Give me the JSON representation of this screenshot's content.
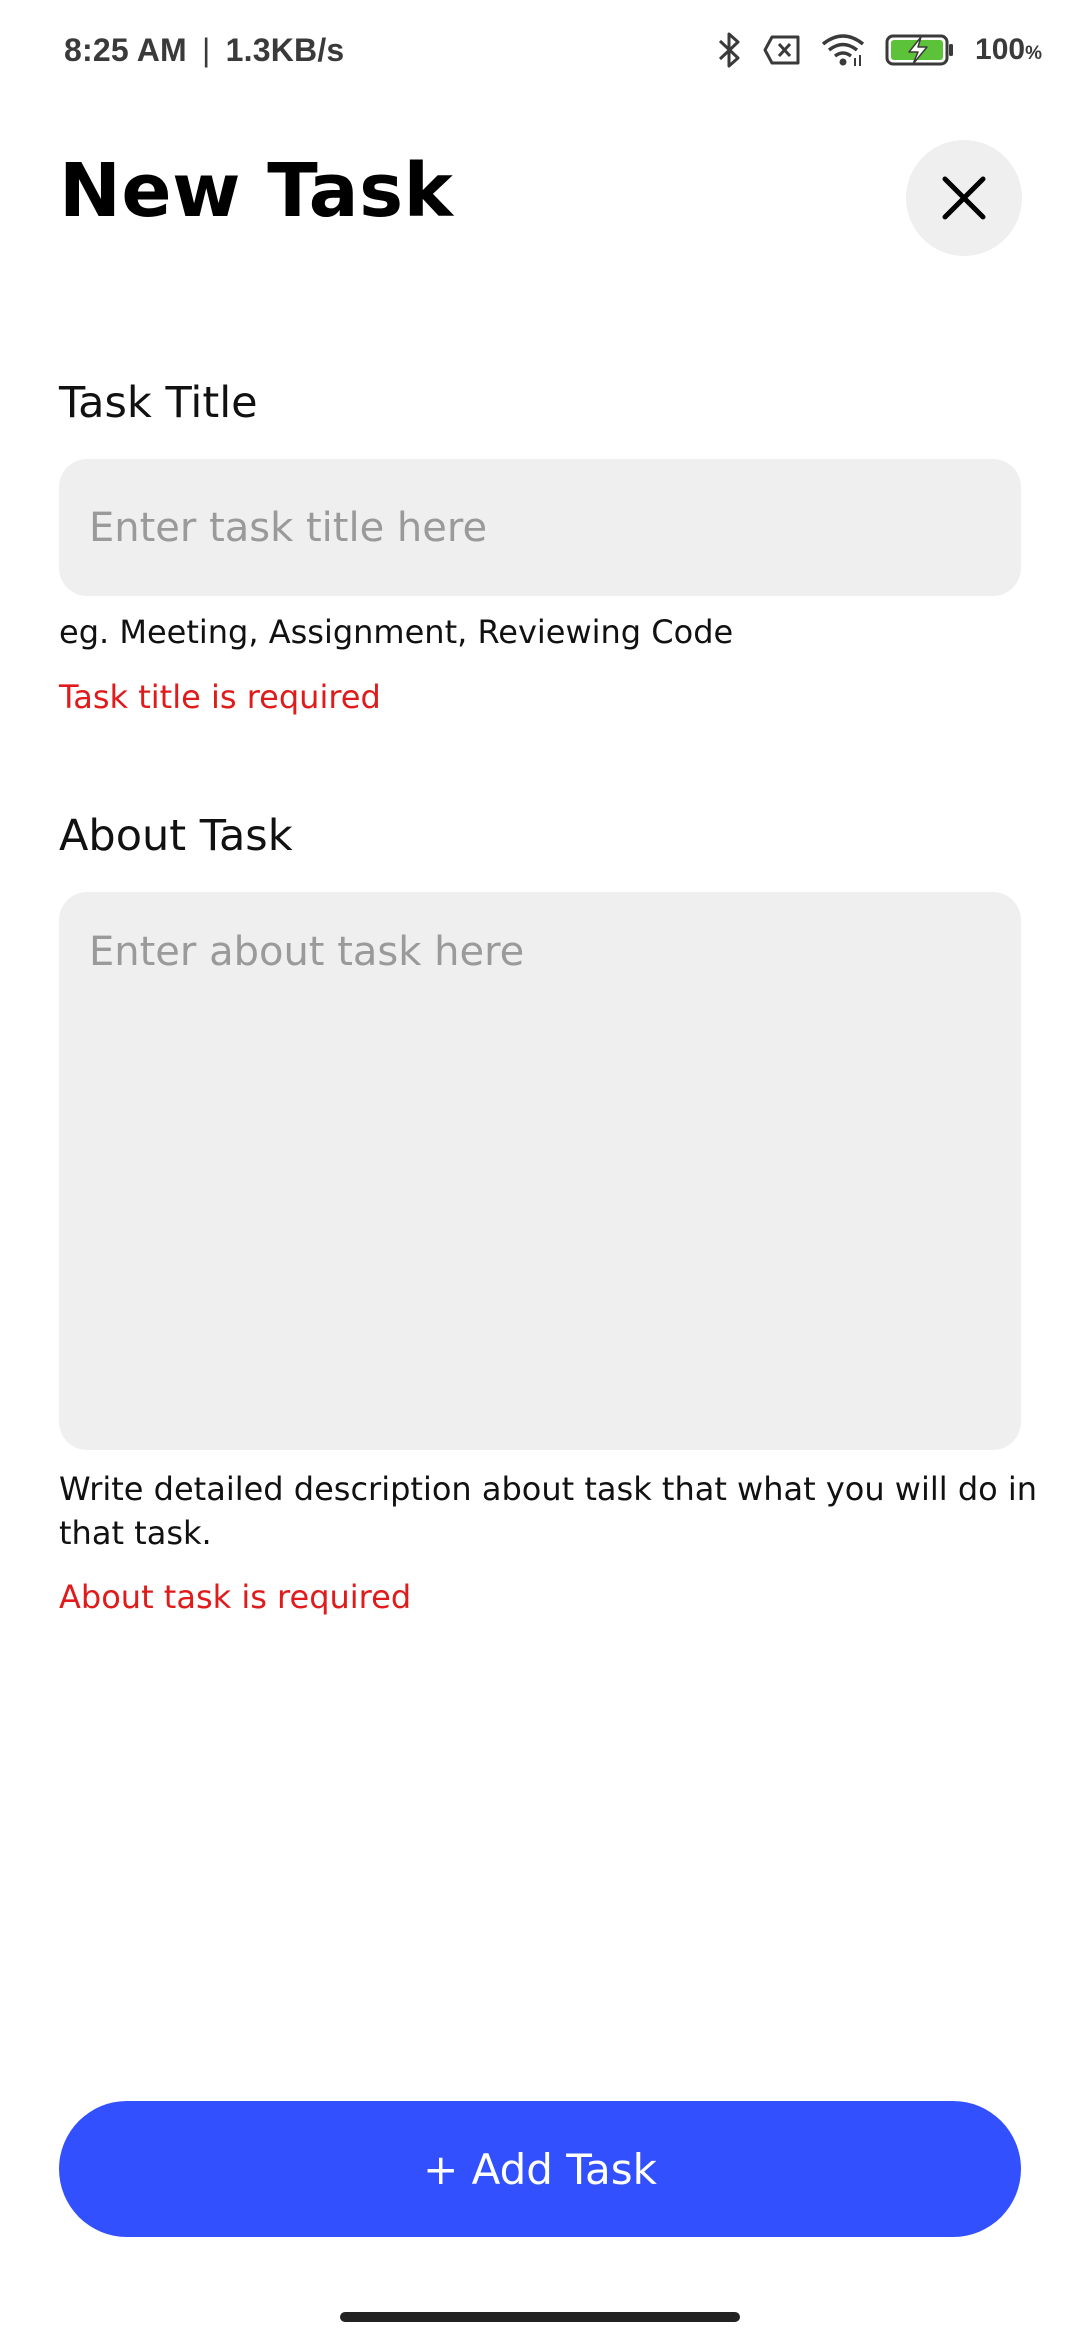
{
  "status_bar": {
    "time": "8:25 AM",
    "separator": "|",
    "network_speed": "1.3KB/s",
    "battery_level": "100",
    "battery_unit": "%",
    "icons": [
      "bluetooth-icon",
      "sim-off-icon",
      "wifi-icon",
      "battery-charging-icon"
    ]
  },
  "header": {
    "title": "New Task",
    "close_icon": "close-icon"
  },
  "task_title": {
    "label": "Task Title",
    "value": "",
    "placeholder": "Enter task title here",
    "helper": "eg. Meeting, Assignment, Reviewing Code",
    "error": "Task title is required"
  },
  "about_task": {
    "label": "About Task",
    "value": "",
    "placeholder": "Enter about task here",
    "helper": "Write detailed description about task that what you will do in that task.",
    "error": "About task is required"
  },
  "actions": {
    "add_label": "+ Add Task"
  },
  "colors": {
    "primary": "#3350ff",
    "error": "#e01b1b",
    "input_bg": "#efefef",
    "battery_green": "#5cc23a"
  }
}
